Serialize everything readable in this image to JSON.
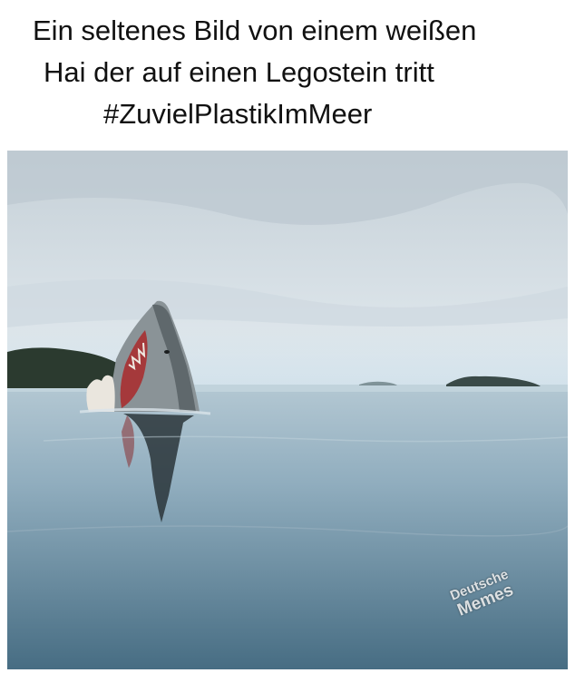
{
  "caption": {
    "line1": "Ein seltenes Bild von einem weißen",
    "line2": "Hai der auf einen Legostein tritt",
    "line3": "#ZuvielPlastikImMeer"
  },
  "watermark": {
    "line1": "Deutsche",
    "line2": "Memes"
  },
  "colors": {
    "sky_top": "#c8d2d9",
    "sky_horizon": "#dfe7ec",
    "water_top": "#a9c0cc",
    "water_bottom": "#4d7388",
    "shark": "#8e979b",
    "mouth": "#a5393b",
    "island": "#2d3a30"
  }
}
